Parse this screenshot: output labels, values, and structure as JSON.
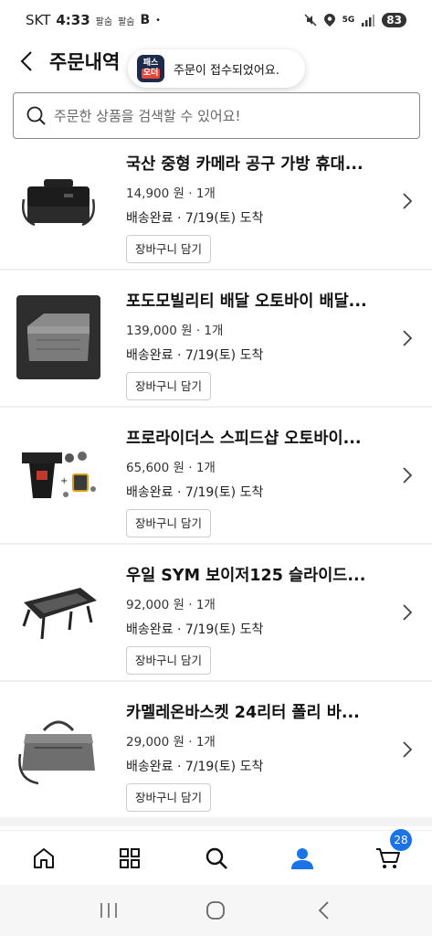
{
  "status_bar": {
    "carrier": "SKT",
    "time": "4:33",
    "indicator_1": "팔숨",
    "indicator_2": "팔숨",
    "indicator_3": "B",
    "indicator_dot": "•",
    "network": "5G",
    "battery": "83"
  },
  "header": {
    "title": "주문내역"
  },
  "toast": {
    "logo_line1": "패스",
    "logo_line2": "오더",
    "message": "주문이 접수되었어요."
  },
  "search": {
    "placeholder": "주문한 상품을 검색할 수 있어요!"
  },
  "orders": [
    {
      "name": "국산 중형 카메라 공구 가방 휴대...",
      "price": "14,900 원 · 1개",
      "status": "배송완료 · 7/19(토) 도착",
      "cart_label": "장바구니 담기"
    },
    {
      "name": "포도모빌리티 배달 오토바이 배달...",
      "price": "139,000 원 · 1개",
      "status": "배송완료 · 7/19(토) 도착",
      "cart_label": "장바구니 담기"
    },
    {
      "name": "프로라이더스 스피드샵 오토바이...",
      "price": "65,600 원 · 1개",
      "status": "배송완료 · 7/19(토) 도착",
      "cart_label": "장바구니 담기"
    },
    {
      "name": "우일 SYM 보이저125 슬라이드...",
      "price": "92,000 원 · 1개",
      "status": "배송완료 · 7/19(토) 도착",
      "cart_label": "장바구니 담기"
    },
    {
      "name": "카멜레온바스켓 24리터 폴리 바...",
      "price": "29,000 원 · 1개",
      "status": "배송완료 · 7/19(토) 도착",
      "cart_label": "장바구니 담기"
    }
  ],
  "bottom_nav": {
    "items": [
      "home-icon",
      "category-grid-icon",
      "search-icon",
      "my-page-icon",
      "cart-icon"
    ],
    "cart_count": "28",
    "active_color": "#1a73e8"
  },
  "system_nav": {
    "items": [
      "recent-apps-icon",
      "home-circle-icon",
      "back-icon"
    ]
  }
}
